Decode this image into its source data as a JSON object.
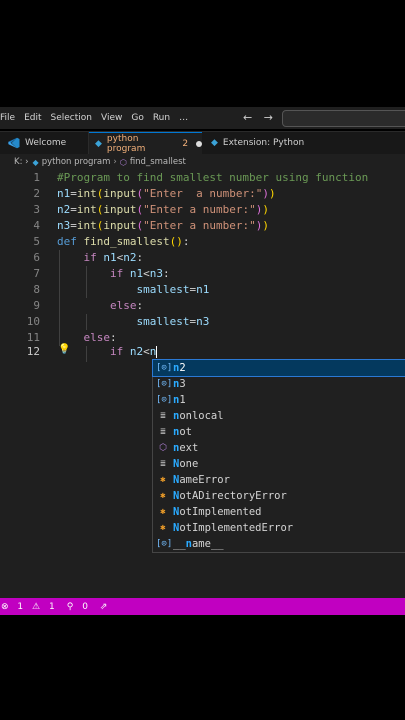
{
  "menu": {
    "items": [
      "File",
      "Edit",
      "Selection",
      "View",
      "Go",
      "Run",
      "…"
    ],
    "nav_back": "←",
    "nav_forward": "→"
  },
  "tabs": [
    {
      "label": "Welcome",
      "icon": "vscode-logo-icon"
    },
    {
      "label": "python program",
      "problems": "2",
      "icon": "python-file-icon",
      "modified": true
    },
    {
      "label": "Extension: Python",
      "icon": "extension-icon"
    }
  ],
  "breadcrumb": {
    "prefix": "K: ›",
    "file": "python program",
    "symbol": "find_smallest"
  },
  "editor": {
    "line_numbers": [
      "1",
      "2",
      "3",
      "4",
      "5",
      "6",
      "7",
      "8",
      "9",
      "10",
      "11",
      "12"
    ],
    "active_line": "12"
  },
  "suggestions": [
    {
      "label": "n2",
      "kind": "variable"
    },
    {
      "label": "n3",
      "kind": "variable"
    },
    {
      "label": "n1",
      "kind": "variable"
    },
    {
      "label": "nonlocal",
      "kind": "keyword"
    },
    {
      "label": "not",
      "kind": "keyword"
    },
    {
      "label": "next",
      "kind": "function"
    },
    {
      "label": "None",
      "kind": "keyword"
    },
    {
      "label": "NameError",
      "kind": "class"
    },
    {
      "label": "NotADirectoryError",
      "kind": "class"
    },
    {
      "label": "NotImplemented",
      "kind": "class"
    },
    {
      "label": "NotImplementedError",
      "kind": "class"
    },
    {
      "label": "__name__",
      "kind": "variable"
    }
  ],
  "status": {
    "errors": "1",
    "warnings": "1",
    "ports": "0"
  },
  "colors": {
    "status_bar": "#c100c1",
    "accent": "#0078d4",
    "selection": "#04395e"
  }
}
